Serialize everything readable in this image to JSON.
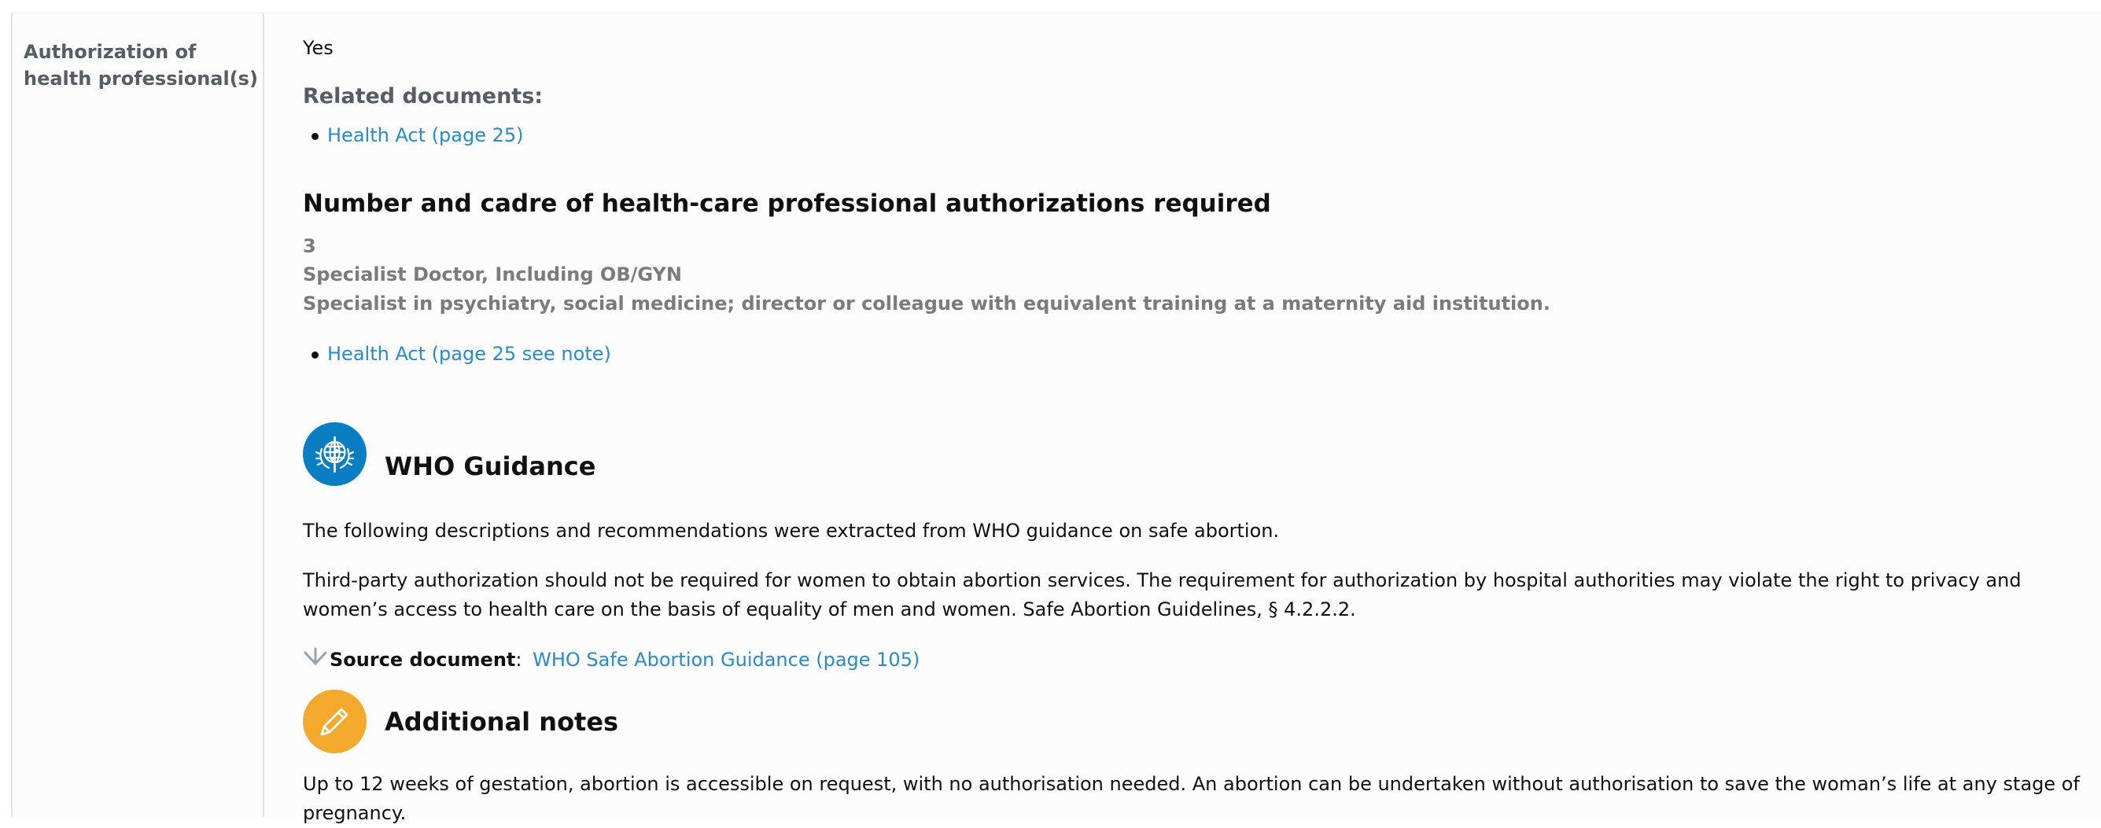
{
  "row_label": "Authorization of health professional(s)",
  "answer": "Yes",
  "related": {
    "heading": "Related documents:",
    "link": "Health Act (page 25)"
  },
  "number_section": {
    "heading": "Number and cadre of health-care professional authorizations required",
    "count": "3",
    "cadre_1": "Specialist Doctor, Including OB/GYN",
    "cadre_2": "Specialist in psychiatry, social medicine; director or colleague with equivalent training at a maternity aid institution.",
    "link": "Health Act (page 25 see note)"
  },
  "who": {
    "heading": "WHO Guidance",
    "intro": "The following descriptions and recommendations were extracted from WHO guidance on safe abortion.",
    "body": "Third-party authorization should not be required for women to obtain abortion services. The requirement for authorization by hospital authorities may violate the right to privacy and women’s access to health care on the basis of equality of men and women. Safe Abortion Guidelines, § 4.2.2.2.",
    "source_label": "Source document",
    "source_sep": ":",
    "source_link": "WHO Safe Abortion Guidance (page 105)",
    "icon": "who-emblem-icon",
    "icon_color": "#0a7ec2"
  },
  "notes": {
    "heading": "Additional notes",
    "body": "Up to 12 weeks of gestation, abortion is accessible on request, with no authorisation needed. An abortion can be undertaken without authorisation to save the woman’s life at any stage of pregnancy.",
    "icon": "pencil-icon",
    "icon_color": "#f3a92b"
  },
  "colors": {
    "link": "#2b8ac8",
    "label": "#555d66",
    "muted": "#7b7b7b"
  }
}
